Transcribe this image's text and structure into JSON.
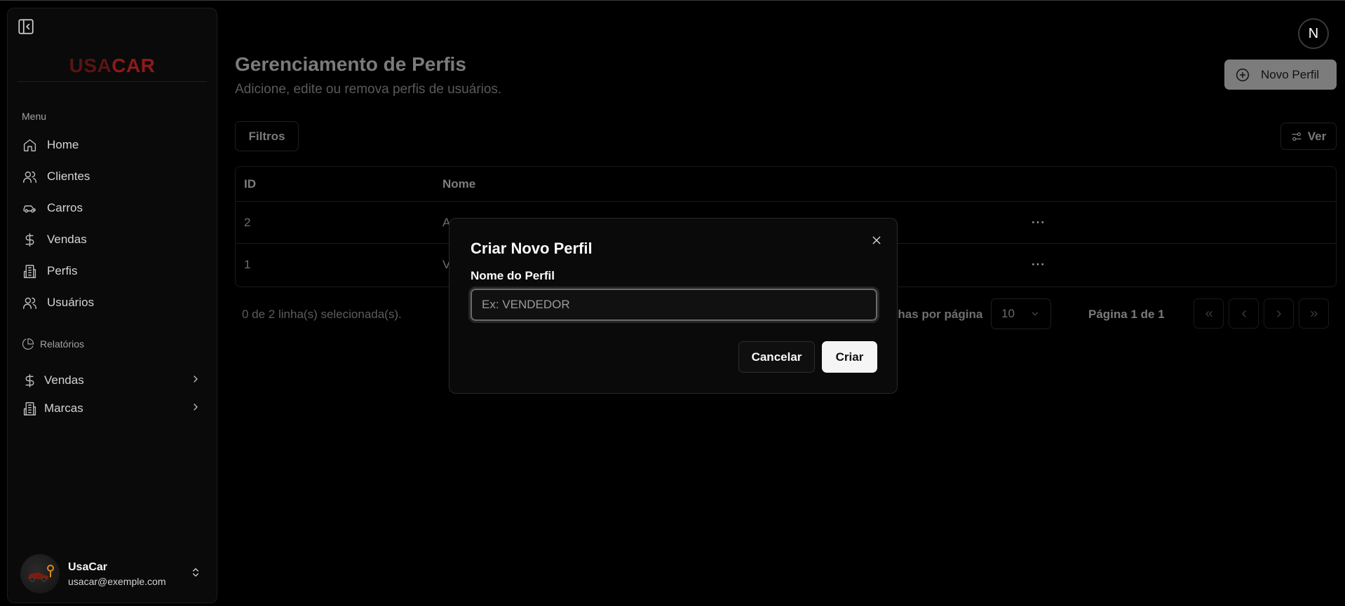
{
  "sidebar": {
    "logo_part1": "USA",
    "logo_part2": "CAR",
    "menu_label": "Menu",
    "items": [
      {
        "label": "Home"
      },
      {
        "label": "Clientes"
      },
      {
        "label": "Carros"
      },
      {
        "label": "Vendas"
      },
      {
        "label": "Perfis"
      },
      {
        "label": "Usuários"
      }
    ],
    "reports_label": "Relatórios",
    "report_items": [
      {
        "label": "Vendas"
      },
      {
        "label": "Marcas"
      }
    ],
    "user": {
      "name": "UsaCar",
      "email": "usacar@exemple.com"
    }
  },
  "header": {
    "title": "Gerenciamento de Perfis",
    "subtitle": "Adicione, edite ou remova perfis de usuários.",
    "new_button": "Novo Perfil",
    "avatar_letter": "N"
  },
  "toolbar": {
    "filters": "Filtros",
    "view": "Ver"
  },
  "table": {
    "columns": [
      "ID",
      "Nome"
    ],
    "rows": [
      {
        "id": "2",
        "nome": "A"
      },
      {
        "id": "1",
        "nome": "V"
      }
    ],
    "row_menu": "···"
  },
  "footer": {
    "selected": "0 de 2 linha(s) selecionada(s).",
    "rows_per_page_label": "nhas por página",
    "rows_per_page": "10",
    "page": "Página 1 de 1"
  },
  "modal": {
    "title": "Criar Novo Perfil",
    "field_label": "Nome do Perfil",
    "placeholder": "Ex: VENDEDOR",
    "value": "",
    "cancel": "Cancelar",
    "create": "Criar"
  },
  "colors": {
    "background": "#000000",
    "sidebar": "#0a0a0a",
    "primary_button": "#f5f5f5",
    "logo_red": "#8d1a1a"
  }
}
